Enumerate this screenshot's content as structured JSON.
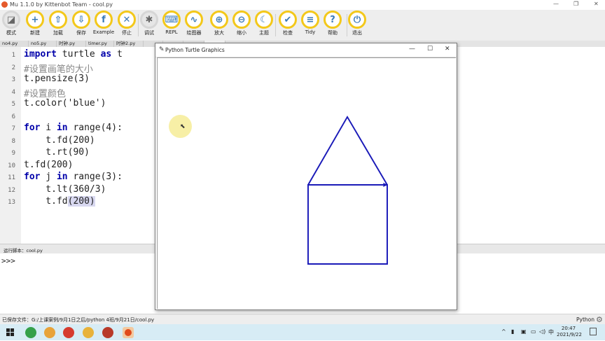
{
  "window": {
    "title": "Mu 1.1.0 by Kittenbot Team - cool.py",
    "controls": [
      "—",
      "❐",
      "✕"
    ]
  },
  "toolbar": {
    "buttons": [
      {
        "label": "模式",
        "icon": "mode-icon",
        "glyph": "◪"
      },
      {
        "label": "新建",
        "icon": "new-icon",
        "glyph": "+"
      },
      {
        "label": "加载",
        "icon": "load-icon",
        "glyph": "⇧"
      },
      {
        "label": "保存",
        "icon": "save-icon",
        "glyph": "⇩"
      },
      {
        "label": "Example",
        "icon": "example-icon",
        "glyph": "f"
      },
      {
        "label": "停止",
        "icon": "stop-icon",
        "glyph": "✕"
      },
      {
        "label": "调试",
        "icon": "debug-icon",
        "glyph": "✱"
      },
      {
        "label": "REPL",
        "icon": "keyboard-icon",
        "glyph": "⌨"
      },
      {
        "label": "绘图器",
        "icon": "plotter-icon",
        "glyph": "∿"
      },
      {
        "label": "放大",
        "icon": "zoom-in-icon",
        "glyph": "⊕"
      },
      {
        "label": "缩小",
        "icon": "zoom-out-icon",
        "glyph": "⊖"
      },
      {
        "label": "主题",
        "icon": "theme-moon-icon",
        "glyph": "☾"
      },
      {
        "label": "检查",
        "icon": "check-thumb-icon",
        "glyph": "✔"
      },
      {
        "label": "Tidy",
        "icon": "tidy-icon",
        "glyph": "≡"
      },
      {
        "label": "帮助",
        "icon": "help-icon",
        "glyph": "?"
      },
      {
        "label": "退出",
        "icon": "power-icon",
        "glyph": "⏻"
      }
    ]
  },
  "tabs": [
    "no4.py",
    "no5.py",
    "时钟.py",
    "timer.py",
    "时钟2.py",
    "",
    "",
    "",
    ""
  ],
  "editor": {
    "line_numbers": [
      "1",
      "2",
      "3",
      "4",
      "5",
      "6",
      "7",
      "8",
      "9",
      "10",
      "11",
      "12",
      "13"
    ],
    "lines": [
      [
        {
          "t": "import",
          "c": "kw"
        },
        {
          "t": " turtle ",
          "c": ""
        },
        {
          "t": "as",
          "c": "kw"
        },
        {
          "t": " t",
          "c": ""
        }
      ],
      [
        {
          "t": "#设置画笔的大小",
          "c": "cmt"
        }
      ],
      [
        {
          "t": "t.pensize(3)",
          "c": ""
        }
      ],
      [
        {
          "t": "#设置颜色",
          "c": "cmt"
        }
      ],
      [
        {
          "t": "t.color('blue')",
          "c": ""
        }
      ],
      [],
      [
        {
          "t": "for",
          "c": "kw"
        },
        {
          "t": " i ",
          "c": ""
        },
        {
          "t": "in",
          "c": "kw"
        },
        {
          "t": " range(4):",
          "c": ""
        }
      ],
      [
        {
          "t": "    t.fd(200)",
          "c": ""
        }
      ],
      [
        {
          "t": "    t.rt(90)",
          "c": ""
        }
      ],
      [
        {
          "t": "t.fd(200)",
          "c": ""
        }
      ],
      [
        {
          "t": "for",
          "c": "kw"
        },
        {
          "t": " j ",
          "c": ""
        },
        {
          "t": "in",
          "c": "kw"
        },
        {
          "t": " range(3):",
          "c": ""
        }
      ],
      [
        {
          "t": "    t.lt(360/3)",
          "c": ""
        }
      ],
      [
        {
          "t": "    t.fd",
          "c": ""
        },
        {
          "t": "(200)",
          "c": "paren-hl"
        }
      ]
    ]
  },
  "run_label": "运行脚本：cool.py",
  "repl": {
    "prompt": ">>>"
  },
  "statusbar": {
    "message": "已保存文件：G:/上课案例/9月1日之后/python 4班/9月21日/cool.py",
    "mode": "Python"
  },
  "turtle_window": {
    "title": "Python Turtle Graphics",
    "controls": [
      "—",
      "☐",
      "✕"
    ],
    "pen_color": "#1a1ab8",
    "pen_size": 3
  },
  "taskbar": {
    "apps": [
      "windows-start-icon",
      "edge-icon",
      "pycharm-icon",
      "chrome-icon",
      "folder-icon",
      "mu-editor-icon",
      "record-icon"
    ],
    "tray": [
      "^",
      "▮",
      "▣",
      "▭",
      "◁)",
      "中"
    ],
    "time": "20:47",
    "date": "2021/9/22"
  }
}
